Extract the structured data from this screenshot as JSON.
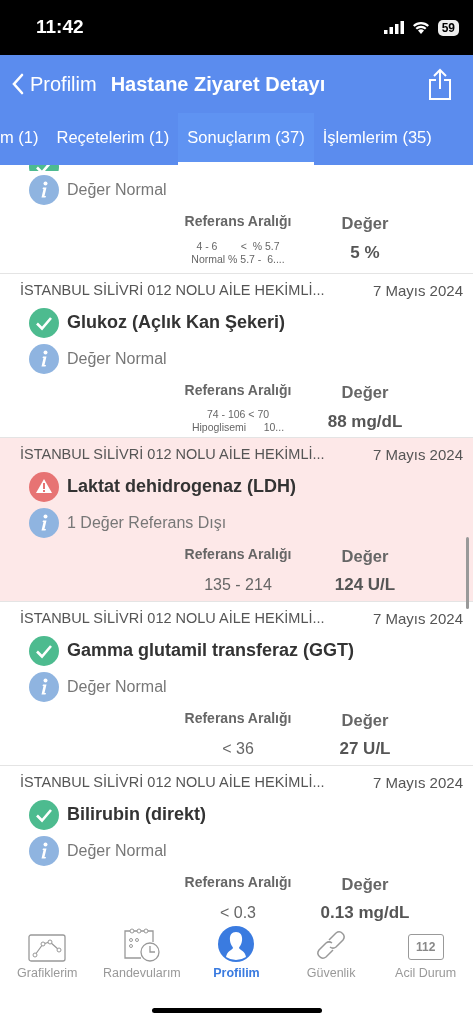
{
  "status_bar": {
    "time": "11:42",
    "battery": "59"
  },
  "nav": {
    "back_label": "Profilim",
    "title": "Hastane Ziyaret Detayı"
  },
  "tabs": [
    {
      "label": "m (1)",
      "selected": false
    },
    {
      "label": "Reçetelerim (1)",
      "selected": false
    },
    {
      "label": "Sonuçlarım (37)",
      "selected": true
    },
    {
      "label": "İşlemlerim (35)",
      "selected": false
    }
  ],
  "results": [
    {
      "out_of_range": false,
      "info": "Değer Normal",
      "ref_header": "Referans Aralığı",
      "value_header": "Değer",
      "reference_lines": [
        "4 - 6        <  % 5.7",
        "Normal % 5.7 -  6...."
      ],
      "value": "5 %"
    },
    {
      "out_of_range": false,
      "facility": "İSTANBUL SİLİVRİ 012 NOLU AİLE HEKİMLİ...",
      "date": "7 Mayıs 2024",
      "title": "Glukoz (Açlık Kan Şekeri)",
      "info": "Değer Normal",
      "ref_header": "Referans Aralığı",
      "value_header": "Değer",
      "reference_lines": [
        "74 - 106 < 70",
        "Hipoglisemi      10..."
      ],
      "value": "88 mg/dL"
    },
    {
      "out_of_range": true,
      "facility": "İSTANBUL SİLİVRİ 012 NOLU AİLE HEKİMLİ...",
      "date": "7 Mayıs 2024",
      "title": "Laktat dehidrogenaz (LDH)",
      "info": "1 Değer Referans Dışı",
      "ref_header": "Referans Aralığı",
      "value_header": "Değer",
      "reference_lines": [
        "135 - 214"
      ],
      "value": "124 U/L"
    },
    {
      "out_of_range": false,
      "facility": "İSTANBUL SİLİVRİ 012 NOLU AİLE HEKİMLİ...",
      "date": "7 Mayıs 2024",
      "title": "Gamma glutamil transferaz (GGT)",
      "info": "Değer Normal",
      "ref_header": "Referans Aralığı",
      "value_header": "Değer",
      "reference_lines": [
        "< 36"
      ],
      "value": "27 U/L"
    },
    {
      "out_of_range": false,
      "facility": "İSTANBUL SİLİVRİ 012 NOLU AİLE HEKİMLİ...",
      "date": "7 Mayıs 2024",
      "title": "Bilirubin (direkt)",
      "info": "Değer Normal",
      "ref_header": "Referans Aralığı",
      "value_header": "Değer",
      "reference_lines": [
        "< 0.3"
      ],
      "value": "0.13 mg/dL"
    }
  ],
  "bottom_tabs": [
    {
      "kind": "chart",
      "label": "Grafiklerim",
      "selected": false
    },
    {
      "kind": "calendar",
      "label": "Randevularım",
      "selected": false
    },
    {
      "kind": "profile",
      "label": "Profilim",
      "selected": true
    },
    {
      "kind": "link",
      "label": "Güvenlik",
      "selected": false
    },
    {
      "kind": "emergency",
      "label": "Acil Durum",
      "badge_text": "112",
      "selected": false
    }
  ]
}
